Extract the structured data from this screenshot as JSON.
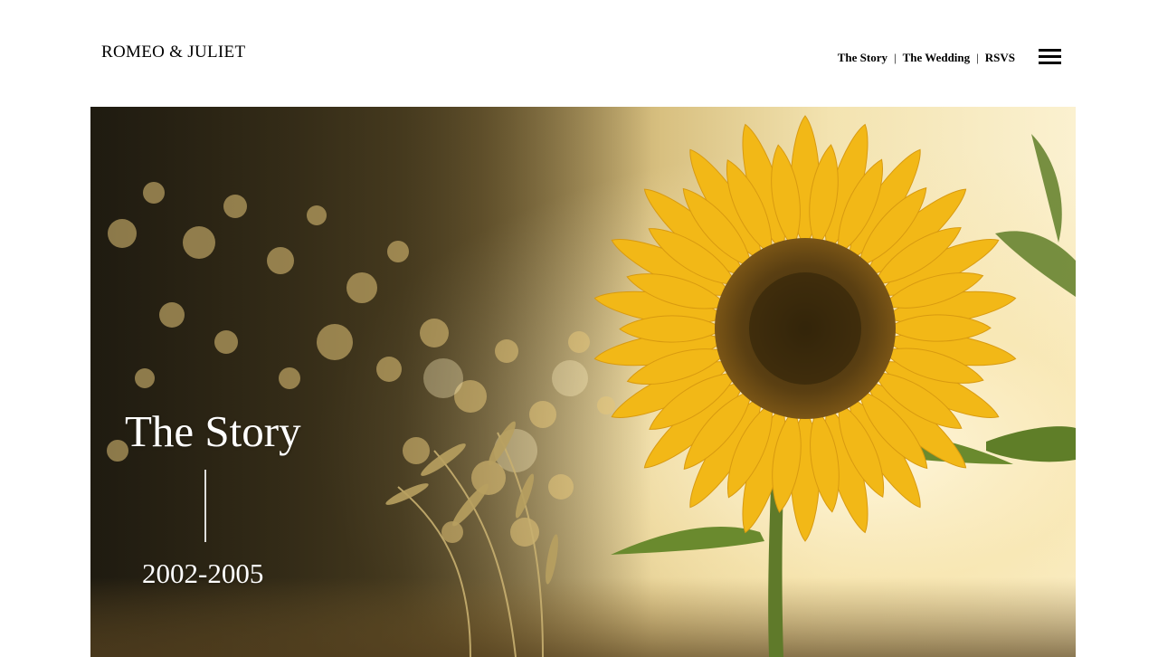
{
  "header": {
    "logo": "ROMEO & JULIET",
    "nav": {
      "items": [
        {
          "label": "The Story"
        },
        {
          "label": "The Wedding"
        },
        {
          "label": "RSVS"
        }
      ],
      "separator": "|"
    },
    "menu_icon": "hamburger-menu-icon"
  },
  "hero": {
    "image": "sunflower-at-sunset-photo",
    "title": "The Story",
    "years": "2002-2005"
  },
  "colors": {
    "text_dark": "#000000",
    "hero_text": "#ffffff",
    "petal": "#f2b817",
    "sunflower_center": "#4a3410"
  }
}
